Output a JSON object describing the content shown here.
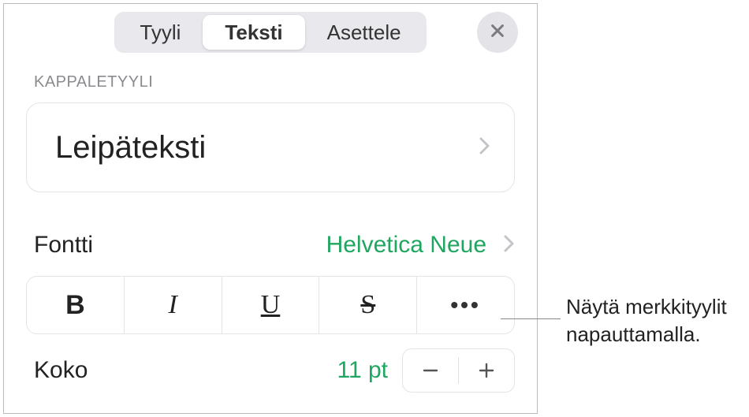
{
  "tabs": {
    "style": "Tyyli",
    "text": "Teksti",
    "layout": "Asettele"
  },
  "section_paragraph_style": "KAPPALETYYLI",
  "paragraph_style_value": "Leipäteksti",
  "font": {
    "label": "Fontti",
    "value": "Helvetica Neue"
  },
  "format_buttons": {
    "bold": "B",
    "italic": "I",
    "underline": "U",
    "strike": "S",
    "more": "•••"
  },
  "size": {
    "label": "Koko",
    "value": "11 pt"
  },
  "callout": {
    "line1": "Näytä merkkityylit",
    "line2": "napauttamalla."
  }
}
